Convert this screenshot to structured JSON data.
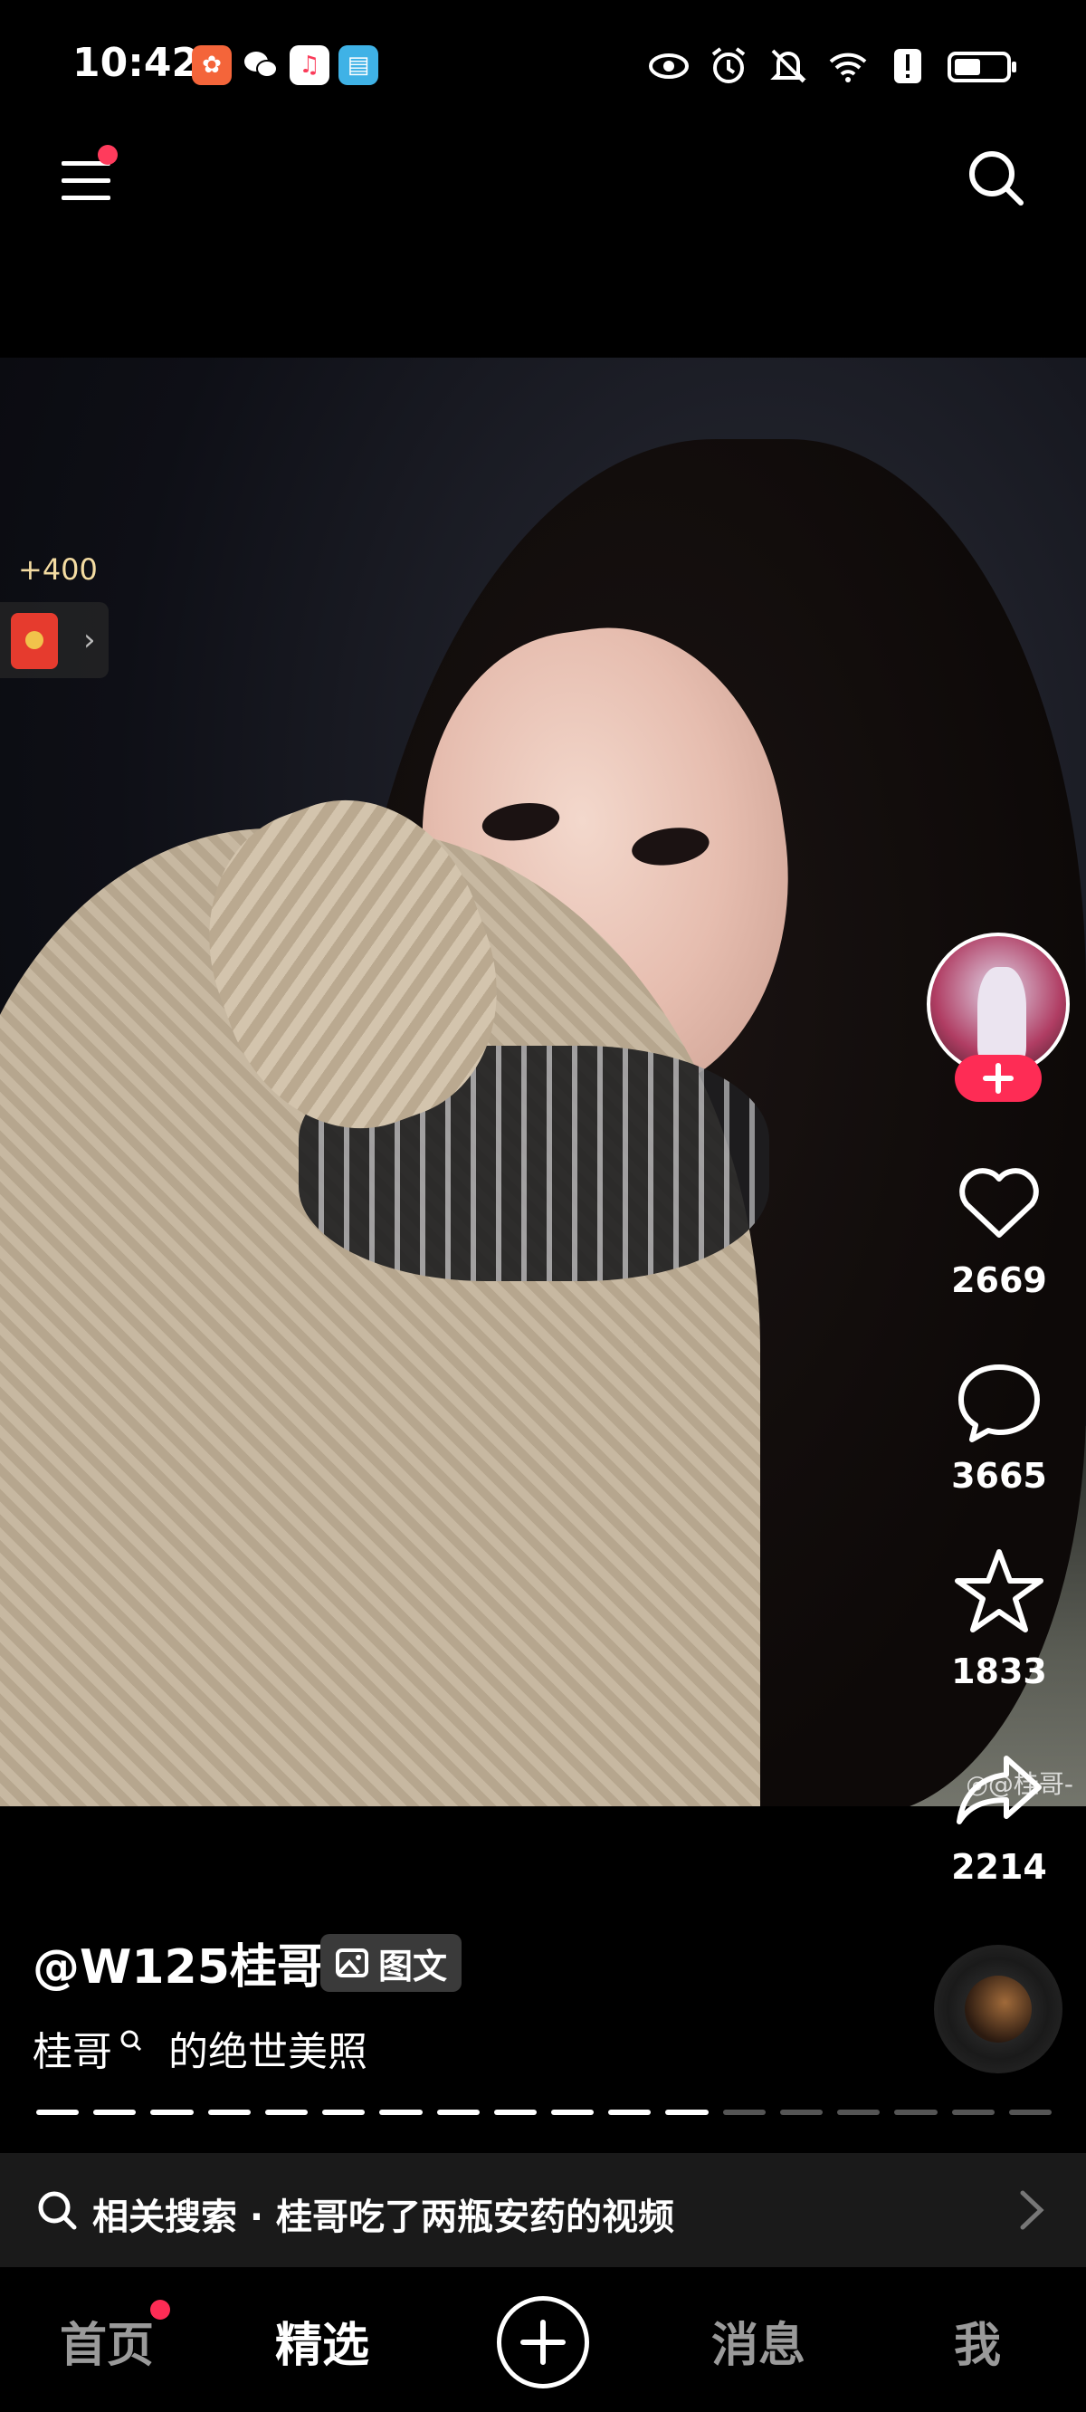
{
  "status_bar": {
    "time": "10:42",
    "apps": [
      {
        "name": "kuaishou-icon",
        "color": "#f4653a",
        "glyph": "✿"
      },
      {
        "name": "wechat-icon",
        "color": "#000000",
        "glyph": "💬"
      },
      {
        "name": "music-icon",
        "color": "#ffffff",
        "glyph": "♫"
      },
      {
        "name": "book-icon",
        "color": "#3fb2e6",
        "glyph": "▤"
      }
    ],
    "right_icons": [
      "eye-icon",
      "alarm-icon",
      "mute-bell-icon",
      "wifi-icon",
      "alert-icon",
      "battery-icon"
    ]
  },
  "reward": {
    "amount": "+400",
    "arrow": "›"
  },
  "photo": {
    "watermark": "◎@桂哥-"
  },
  "actions": {
    "follow": "+",
    "likes": "2669",
    "comments": "3665",
    "favorites": "1833",
    "shares": "2214"
  },
  "post": {
    "author": "@W125桂哥",
    "type_label": "图文",
    "caption_keyword": "桂哥",
    "caption_rest": "的绝世美照",
    "progress_total": 18,
    "progress_current": 12
  },
  "related_search": {
    "text": "相关搜索 · 桂哥吃了两瓶安药的视频"
  },
  "nav": {
    "home": "首页",
    "featured": "精选",
    "messages": "消息",
    "me": "我"
  },
  "colors": {
    "accent": "#fe2c55",
    "reward_gold": "#f4dca2"
  }
}
